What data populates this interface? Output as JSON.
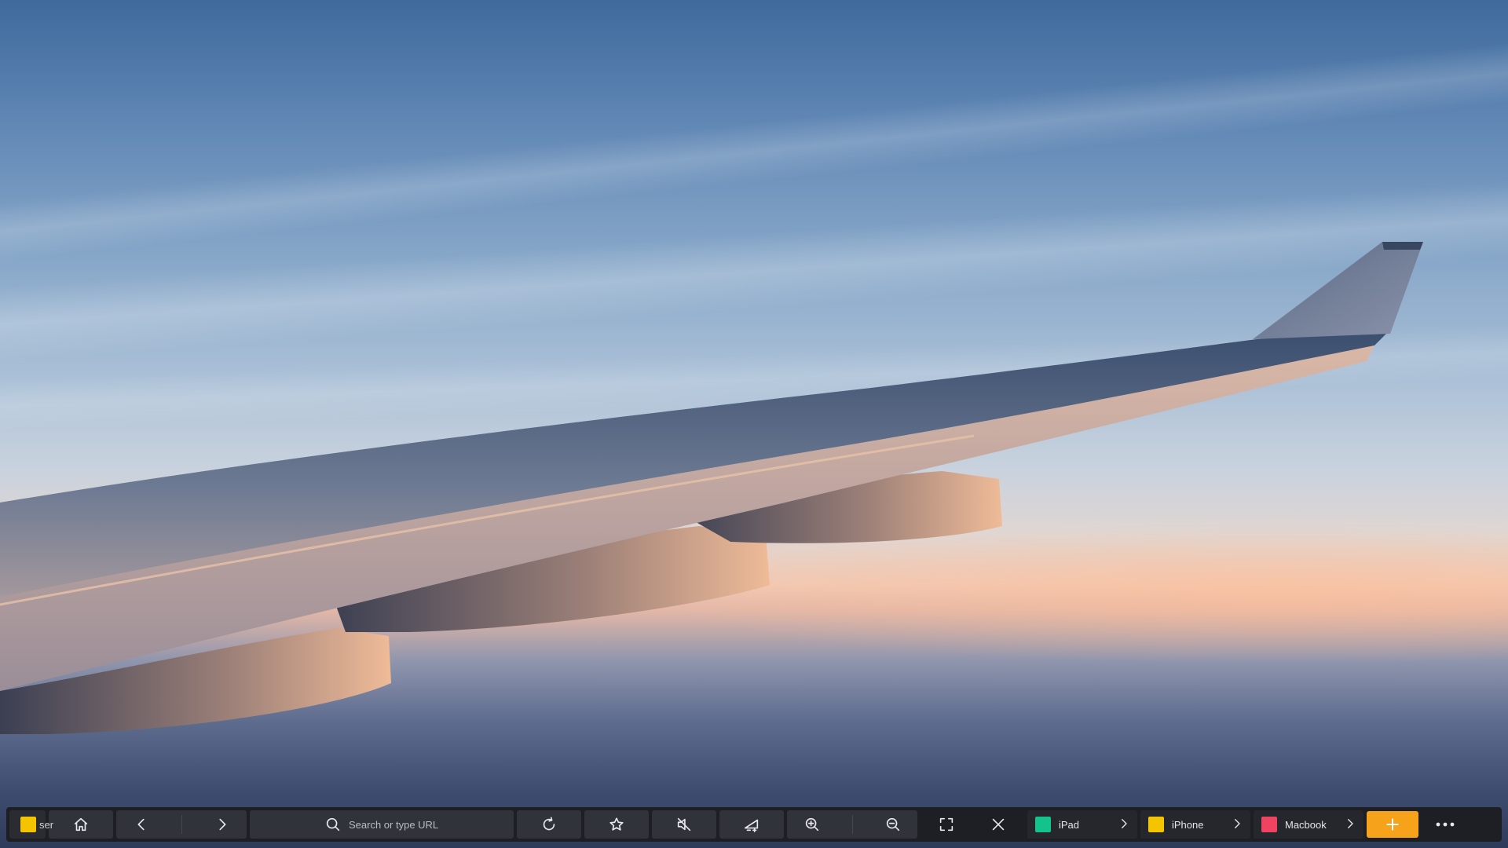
{
  "background": {
    "description_icon": "airplane-wing-sunset-photo"
  },
  "colors": {
    "accent": "#f7a21b",
    "taskbar": "#1d1f24",
    "button": "#30333a",
    "app_tile_color": "#f5c400",
    "ipad_color": "#13c38b",
    "iphone_color": "#f5c400",
    "macbook_color": "#ee4461"
  },
  "taskbar": {
    "app_tile_name": "ser",
    "search_placeholder": "Search or type URL",
    "icons": {
      "home": "home-icon",
      "back": "chevron-left-icon",
      "forward": "chevron-right-icon",
      "search": "search-icon",
      "reload": "reload-icon",
      "bookmark": "star-icon",
      "mute": "mute-icon",
      "volume": "volume-icon",
      "zoom_in": "zoom-in-icon",
      "zoom_out": "zoom-out-icon",
      "fullscreen": "fullscreen-icon",
      "close": "close-icon",
      "add": "plus-icon",
      "more": "more-icon"
    },
    "devices": [
      {
        "name": "iPad"
      },
      {
        "name": "iPhone"
      },
      {
        "name": "Macbook"
      }
    ]
  }
}
